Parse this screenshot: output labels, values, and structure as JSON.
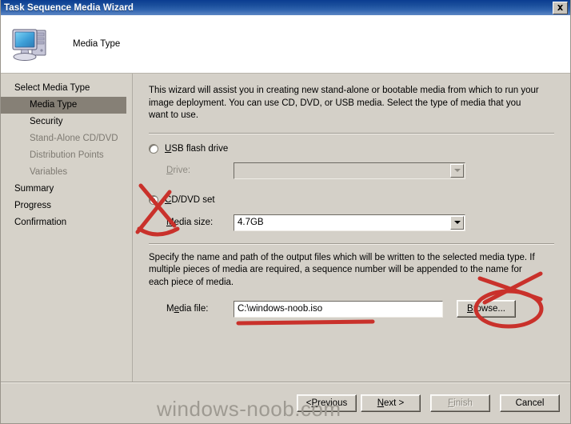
{
  "window": {
    "title": "Task Sequence Media Wizard",
    "close_label": "Close"
  },
  "header": {
    "page_title": "Media Type",
    "icon": "computer-icon"
  },
  "sidebar": {
    "items": [
      {
        "label": "Select Media Type",
        "level": "top",
        "state": "normal"
      },
      {
        "label": "Media Type",
        "level": "sub",
        "state": "selected"
      },
      {
        "label": "Security",
        "level": "sub",
        "state": "normal"
      },
      {
        "label": "Stand-Alone CD/DVD",
        "level": "sub",
        "state": "dim"
      },
      {
        "label": "Distribution Points",
        "level": "sub",
        "state": "dim"
      },
      {
        "label": "Variables",
        "level": "sub",
        "state": "dim"
      },
      {
        "label": "Summary",
        "level": "top",
        "state": "normal"
      },
      {
        "label": "Progress",
        "level": "top",
        "state": "normal"
      },
      {
        "label": "Confirmation",
        "level": "top",
        "state": "normal"
      }
    ]
  },
  "content": {
    "intro_text": "This wizard will assist you in creating new stand-alone or bootable media from which to run your image deployment. You can use CD, DVD, or USB media. Select the type of media that you want to use.",
    "usb_radio_label": "USB flash drive",
    "usb_radio_checked": false,
    "drive_label": "Drive:",
    "drive_value": "",
    "cd_radio_label": "CD/DVD set",
    "cd_radio_checked": true,
    "media_size_label": "Media size:",
    "media_size_value": "4.7GB",
    "output_text": "Specify the name and path of the output files which will be written to the selected media type. If multiple pieces of media are required, a sequence number will be appended to the name for each piece of media.",
    "media_file_label": "Media file:",
    "media_file_value": "C:\\windows-noob.iso",
    "browse_label": "Browse..."
  },
  "footer": {
    "previous_label": "< Previous",
    "next_label": "Next >",
    "finish_label": "Finish",
    "finish_disabled": true,
    "cancel_label": "Cancel"
  },
  "watermark": {
    "text": "windows-noob.com"
  },
  "colors": {
    "titlebar_start": "#0b3d91",
    "titlebar_end": "#5d86c4",
    "dialog_bg": "#d4d0c8",
    "sidebar_bg": "#d6d2c9",
    "selected_bg": "#868076",
    "annotation_red": "#c9312b",
    "watermark_gray": "#9e9a92"
  }
}
